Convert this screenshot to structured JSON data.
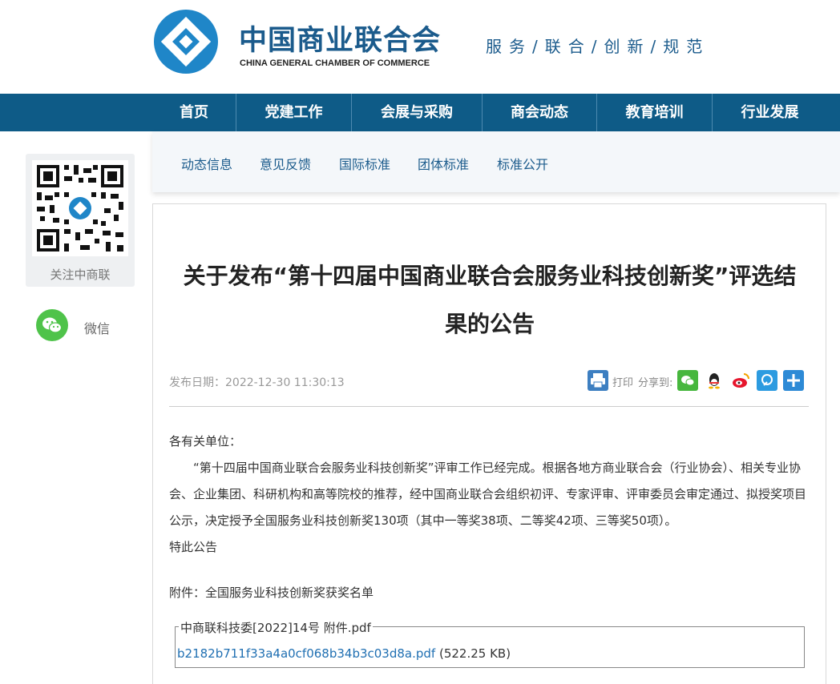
{
  "header": {
    "org_name_cn": "中国商业联合会",
    "org_name_en": "CHINA GENERAL CHAMBER OF COMMERCE",
    "slogan": "服务/联合/创新/规范"
  },
  "nav": {
    "items": [
      {
        "label": "首页"
      },
      {
        "label": "党建工作"
      },
      {
        "label": "会展与采购"
      },
      {
        "label": "商会动态"
      },
      {
        "label": "教育培训"
      },
      {
        "label": "行业发展"
      }
    ],
    "bg_color": "#0e5b87"
  },
  "subnav": {
    "items": [
      {
        "label": "动态信息"
      },
      {
        "label": "意见反馈"
      },
      {
        "label": "国际标准"
      },
      {
        "label": "团体标准"
      },
      {
        "label": "标准公开"
      }
    ]
  },
  "sidebar": {
    "qr_label": "关注中商联",
    "wechat_label": "微信"
  },
  "article": {
    "title": "关于发布“第十四届中国商业联合会服务业科技创新奖”评选结果的公告",
    "publish_date": "发布日期：2022-12-30 11:30:13",
    "print_label": "打印",
    "share_label": "分享到:",
    "greeting": "各有关单位：",
    "paragraph": "“第十四届中国商业联合会服务业科技创新奖”评审工作已经完成。根据各地方商业联合会（行业协会）、相关专业协会、企业集团、科研机构和高等院校的推荐，经中国商业联合会组织初评、专家评审、评审委员会审定通过、拟授奖项目公示，决定授予全国服务业科技创新奖130项（其中一等奖38项、二等奖42项、三等奖50项）。",
    "closing": "特此公告",
    "attachment_line": "附件：全国服务业科技创新奖获奖名单",
    "attachment_legend": "中商联科技委[2022]14号 附件.pdf",
    "attachment_file": "b2182b711f33a4a0cf068b34b3c03d8a.pdf",
    "attachment_size": "(522.25 KB)"
  },
  "colors": {
    "brand_blue": "#1b5b8c",
    "link_blue": "#1f6fb2",
    "wechat_green": "#4fc34a"
  }
}
